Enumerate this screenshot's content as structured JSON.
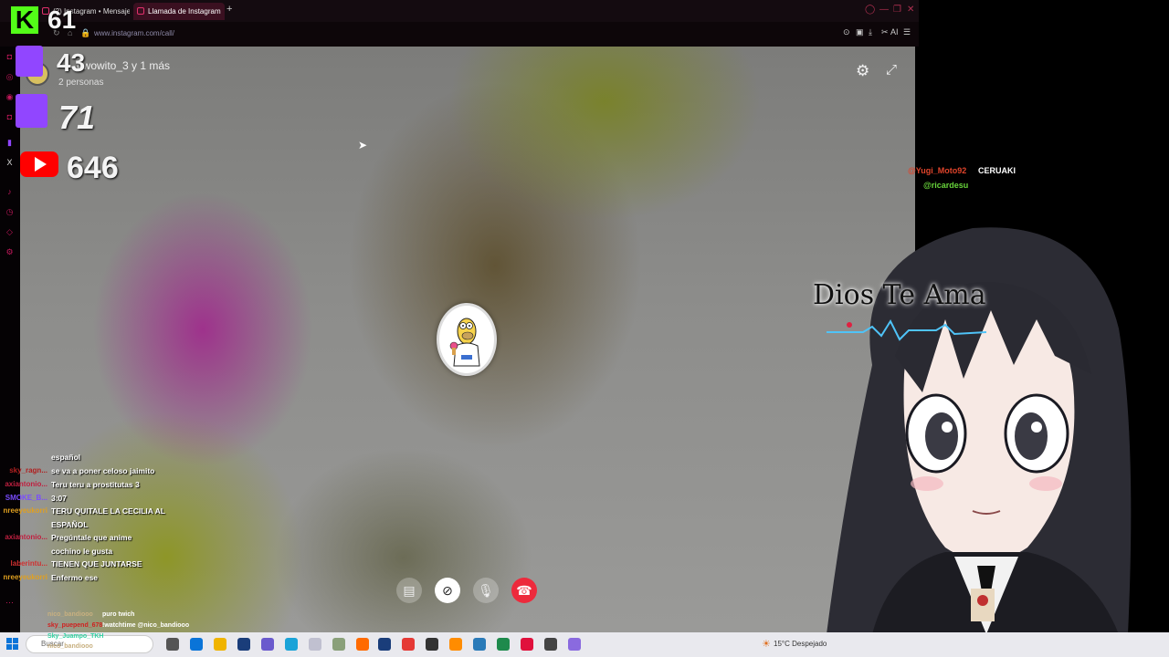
{
  "browser": {
    "tabs": [
      {
        "label": "(2) Instagram • Mensajes"
      },
      {
        "label": "Llamada de Instagram"
      }
    ],
    "new_tab_glyph": "+",
    "url": "www.instagram.com/call/",
    "toolbar_ai_label": "AI"
  },
  "call": {
    "title": "owowito_3 y 1 más",
    "subtitle": "2 personas",
    "controls": [
      "share-screen-icon",
      "video-off-icon",
      "mic-icon",
      "hang-up-icon"
    ]
  },
  "stream_stats": {
    "kick_letter": "K",
    "kick_viewers": "61",
    "twitch_viewers_1": "43",
    "twitch_viewers_2": "71",
    "youtube_viewers": "646"
  },
  "chat": [
    {
      "user": "",
      "user_color": "#ffffff",
      "message": "español"
    },
    {
      "user": "sky_ragn...",
      "user_color": "#b02020",
      "message": "se va a poner celoso jaimito"
    },
    {
      "user": "axiantonio...",
      "user_color": "#c02040",
      "message": "Teru teru a prostitutas 3"
    },
    {
      "user": "SMOKE_B...",
      "user_color": "#7a4cff",
      "message": "3:07"
    },
    {
      "user": "nreeyeukorri",
      "user_color": "#e0a020",
      "message": "TERU QUITALE LA CECILIA AL"
    },
    {
      "user": "",
      "user_color": "#ffffff",
      "message": "ESPAÑOL"
    },
    {
      "user": "axiantonio...",
      "user_color": "#c02040",
      "message": "Pregúntale que anime"
    },
    {
      "user": "",
      "user_color": "#ffffff",
      "message": "cochino le gusta"
    },
    {
      "user": "laberintu...",
      "user_color": "#d03030",
      "message": "TIENEN QUE JUNTARSE"
    },
    {
      "user": "nreeyeukorri",
      "user_color": "#e0a020",
      "message": "Enfermo ese"
    }
  ],
  "bottom_chat": [
    {
      "user": "nico_bandiooo",
      "user_color": "#c8b080",
      "message": "puro twich"
    },
    {
      "user": "sky_puepend_678",
      "user_color": "#d02020",
      "message": "!watchtime @nico_bandiooo"
    },
    {
      "user": "Sky_Juampo_TKH",
      "user_color": "#30d0a0",
      "message": ""
    },
    {
      "user": "nico_bandiooo",
      "user_color": "#c8b080",
      "message": ""
    }
  ],
  "right_chat": {
    "user": "@Yugi_Moto92",
    "message": "CERUAKI",
    "mention": "@ricardesu"
  },
  "overlay_text": "Dios Te Ama",
  "taskbar": {
    "search_placeholder": "Buscar",
    "weather": "15°C  Despejado"
  },
  "colors": {
    "kick": "#53fc18",
    "twitch": "#9146ff",
    "youtube": "#ff0000",
    "hangup": "#ed2a3c",
    "instagram": "#e1306c"
  }
}
